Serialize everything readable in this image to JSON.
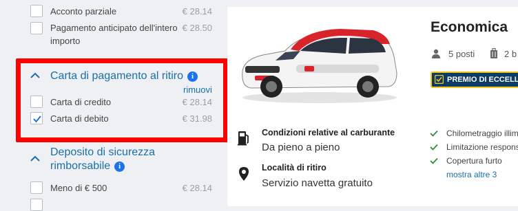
{
  "sidebar": {
    "payment_options": [
      {
        "label": "Acconto parziale",
        "price": "€ 28.14",
        "checked": false
      },
      {
        "label": "Pagamento anticipato dell'intero importo",
        "label_line1": "Pagamento anticipato dell'intero",
        "label_line2": "importo",
        "price": "€ 28.50",
        "checked": false
      }
    ],
    "card_section": {
      "title": "Carta di pagamento al ritiro",
      "remove_link": "rimuovi",
      "options": [
        {
          "label": "Carta di credito",
          "price": "€ 28.14",
          "checked": false
        },
        {
          "label": "Carta di debito",
          "price": "€ 31.98",
          "checked": true
        }
      ]
    },
    "deposit_section": {
      "title_line1": "Deposito di sicurezza",
      "title_line2": "rimborsabile",
      "options": [
        {
          "label": "Meno di € 500",
          "price": "€ 28.14",
          "checked": false
        }
      ]
    }
  },
  "car": {
    "category": "Economica",
    "seats": "5 posti",
    "bags": "2 b",
    "badge": "PREMIO DI ECCELLENZA",
    "fuel_policy_title": "Condizioni relative al carburante",
    "fuel_policy_value": "Da pieno a pieno",
    "pickup_title": "Località di ritiro",
    "pickup_value": "Servizio navetta gratuito",
    "features": [
      "Chilometraggio illimitato",
      "Limitazione responsabilità",
      "Copertura furto"
    ],
    "more_link": "mostra altre 3"
  },
  "colors": {
    "accent": "#1b6fa8",
    "highlight": "#ff0000",
    "badge_bg": "#0c3b66",
    "check": "#2e8b3c"
  }
}
